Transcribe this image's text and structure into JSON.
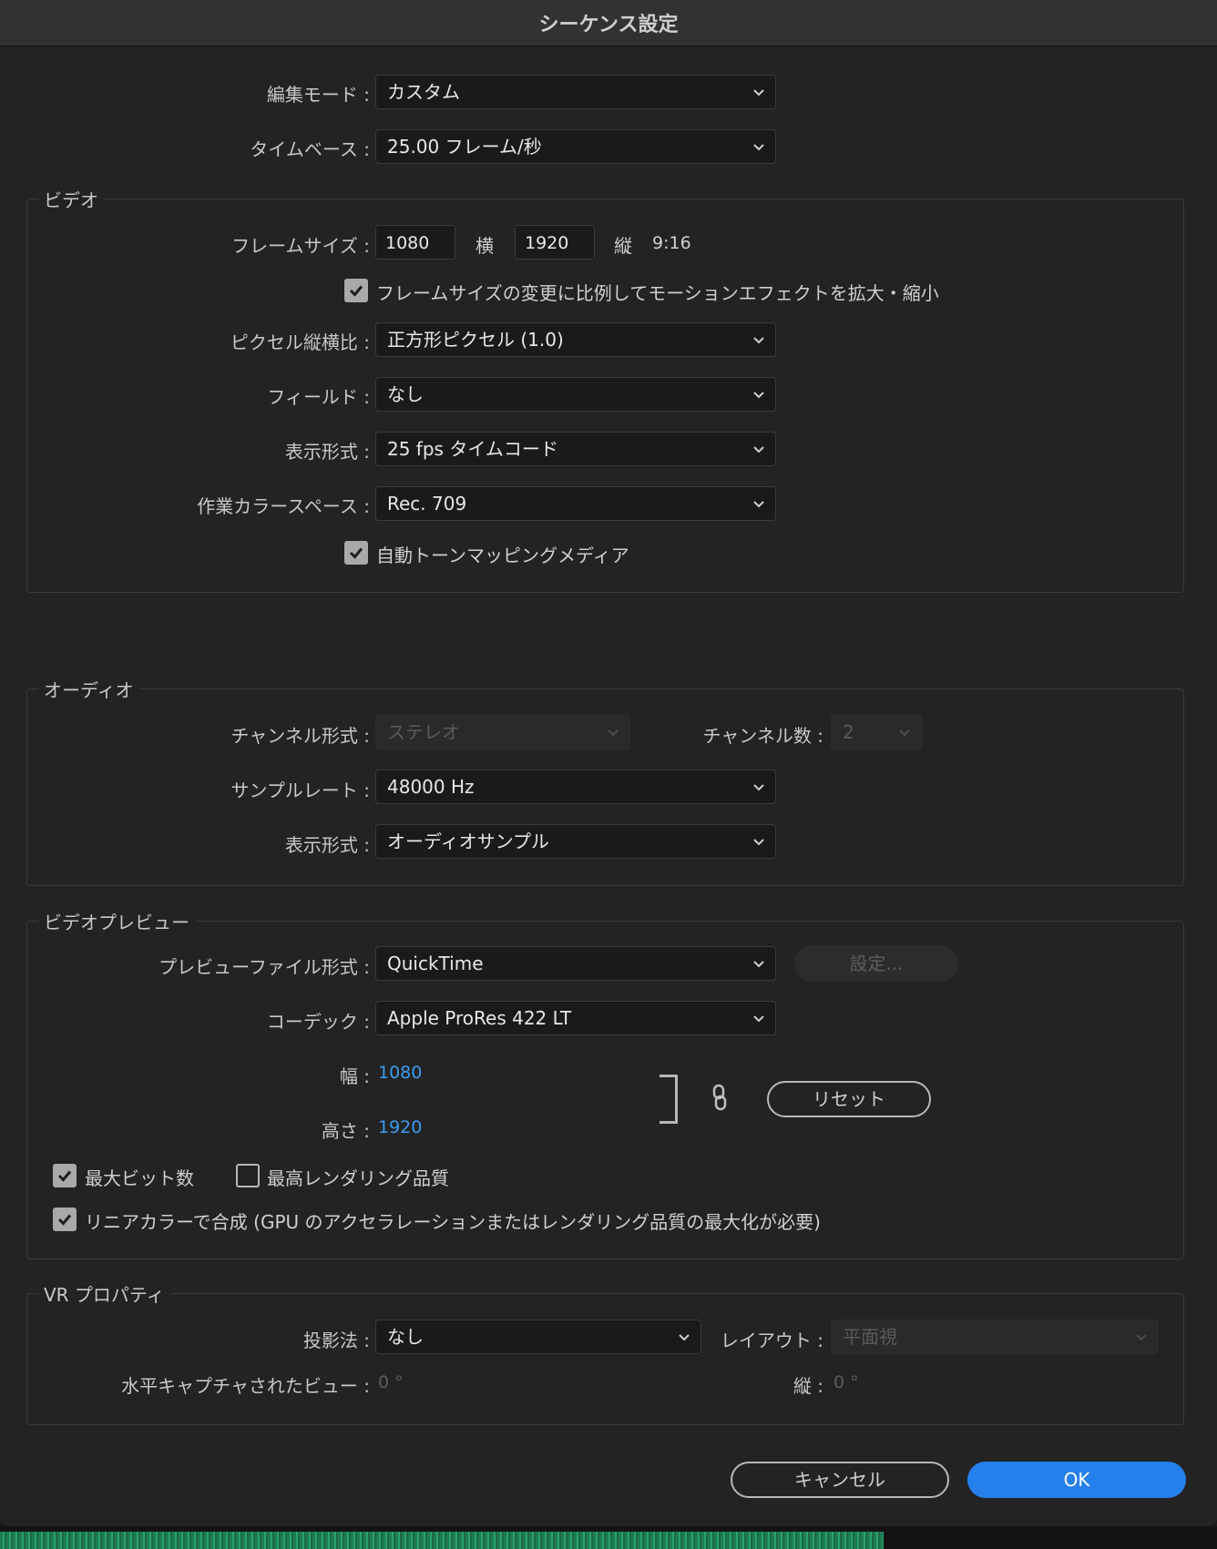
{
  "dialog": {
    "title": "シーケンス設定"
  },
  "top": {
    "edit_mode": {
      "label": "編集モード :",
      "value": "カスタム"
    },
    "timebase": {
      "label": "タイムベース :",
      "value": "25.00  フレーム/秒"
    }
  },
  "video": {
    "group_title": "ビデオ",
    "frame_size": {
      "label": "フレームサイズ :",
      "width": "1080",
      "width_unit": "横",
      "height": "1920",
      "height_unit": "縦",
      "aspect": "9:16"
    },
    "scale_checkbox": {
      "label": "フレームサイズの変更に比例してモーションエフェクトを拡大・縮小",
      "checked": true
    },
    "pixel_aspect": {
      "label": "ピクセル縦横比 :",
      "value": "正方形ピクセル (1.0)"
    },
    "fields": {
      "label": "フィールド :",
      "value": "なし"
    },
    "display_format": {
      "label": "表示形式 :",
      "value": "25 fps タイムコード"
    },
    "color_space": {
      "label": "作業カラースペース :",
      "value": "Rec. 709"
    },
    "tone_mapping": {
      "label": "自動トーンマッピングメディア",
      "checked": true
    }
  },
  "audio": {
    "group_title": "オーディオ",
    "channel_format": {
      "label": "チャンネル形式 :",
      "value": "ステレオ"
    },
    "channel_count": {
      "label": "チャンネル数 :",
      "value": "2"
    },
    "sample_rate": {
      "label": "サンプルレート :",
      "value": "48000 Hz"
    },
    "display_format": {
      "label": "表示形式 :",
      "value": "オーディオサンプル"
    }
  },
  "preview": {
    "group_title": "ビデオプレビュー",
    "file_format": {
      "label": "プレビューファイル形式 :",
      "value": "QuickTime"
    },
    "settings_button": "設定...",
    "codec": {
      "label": "コーデック :",
      "value": "Apple ProRes 422 LT"
    },
    "width": {
      "label": "幅 :",
      "value": "1080"
    },
    "height": {
      "label": "高さ :",
      "value": "1920"
    },
    "reset_button": "リセット",
    "max_bit_depth": {
      "label": "最大ビット数",
      "checked": true
    },
    "max_render_quality": {
      "label": "最高レンダリング品質",
      "checked": false
    },
    "linear_color": {
      "label": "リニアカラーで合成 (GPU のアクセラレーションまたはレンダリング品質の最大化が必要)",
      "checked": true
    }
  },
  "vr": {
    "group_title": "VR プロパティ",
    "projection": {
      "label": "投影法 :",
      "value": "なし"
    },
    "layout": {
      "label": "レイアウト :",
      "value": "平面視"
    },
    "horizontal_view": {
      "label": "水平キャプチャされたビュー :",
      "value": "0 °"
    },
    "vertical": {
      "label": "縦 :",
      "value": "0 °"
    }
  },
  "footer": {
    "cancel": "キャンセル",
    "ok": "OK"
  },
  "colors": {
    "accent": "#2680eb",
    "link": "#3d9bf0",
    "background": "#232323"
  },
  "icons": [
    "chevron-down-icon",
    "checkmark-icon",
    "link-icon"
  ]
}
